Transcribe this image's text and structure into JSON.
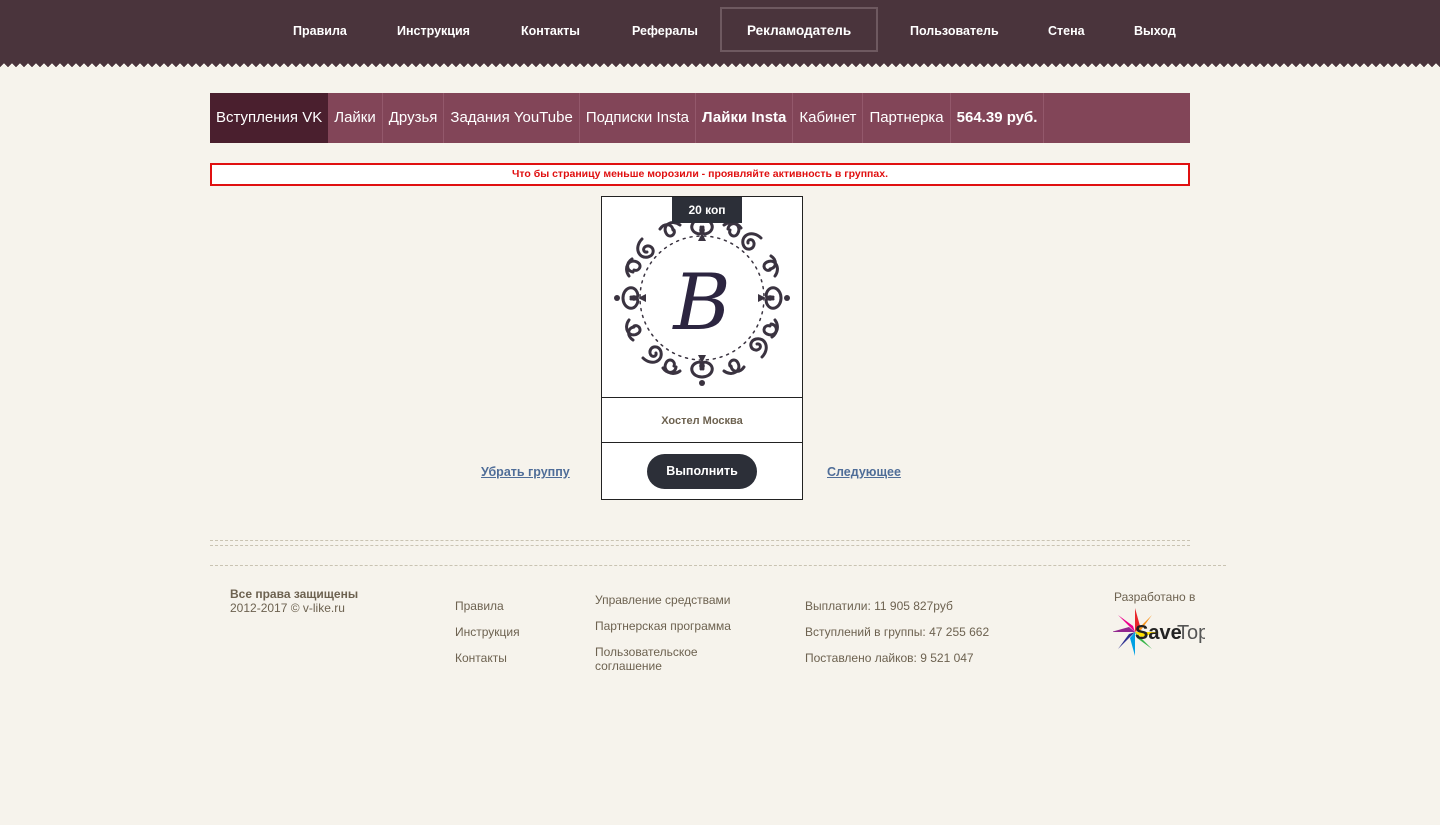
{
  "topnav": {
    "items": [
      {
        "label": "Правила"
      },
      {
        "label": "Инструкция"
      },
      {
        "label": "Контакты"
      },
      {
        "label": "Рефералы"
      },
      {
        "label": "Рекламодатель"
      },
      {
        "label": "Пользователь"
      },
      {
        "label": "Стена"
      },
      {
        "label": "Выход"
      }
    ]
  },
  "subnav": {
    "items": [
      {
        "label": "Вступления VK"
      },
      {
        "label": "Лайки"
      },
      {
        "label": "Друзья"
      },
      {
        "label": "Задания YouTube"
      },
      {
        "label": "Подписки Insta"
      },
      {
        "label": "Лайки Insta"
      },
      {
        "label": "Кабинет"
      },
      {
        "label": "Партнерка"
      },
      {
        "label": "564.39 руб."
      }
    ]
  },
  "notice": {
    "text": "Что бы страницу меньше морозили - проявляйте активность в группах."
  },
  "task": {
    "price": "20 коп",
    "name": "Хостел Москва",
    "monogram": "B",
    "do_label": "Выполнить",
    "remove_label": "Убрать группу",
    "next_label": "Следующее"
  },
  "footer": {
    "rights_title": "Все права защищены",
    "rights_sub": "2012-2017 © v-like.ru",
    "col1": [
      "Правила",
      "Инструкция",
      "Контакты"
    ],
    "col2": [
      "Управление средствами",
      "Партнерская программа",
      "Пользовательское соглашение"
    ],
    "stats": [
      "Выплатили: 11 905 827руб",
      "Вступлений в группы: 47 255 662",
      "Поставлено лайков: 9 521 047"
    ],
    "developed_by": "Разработано в",
    "brand_save": "Save",
    "brand_top": "Top"
  },
  "colors": {
    "header_bg": "#4a343c",
    "subnav_bg": "#824558",
    "subnav_active": "#4a1f2e",
    "notice_red": "#e01010",
    "button_dark": "#2c2f38",
    "link_blue": "#4f6d98",
    "page_bg": "#f6f3ec"
  }
}
